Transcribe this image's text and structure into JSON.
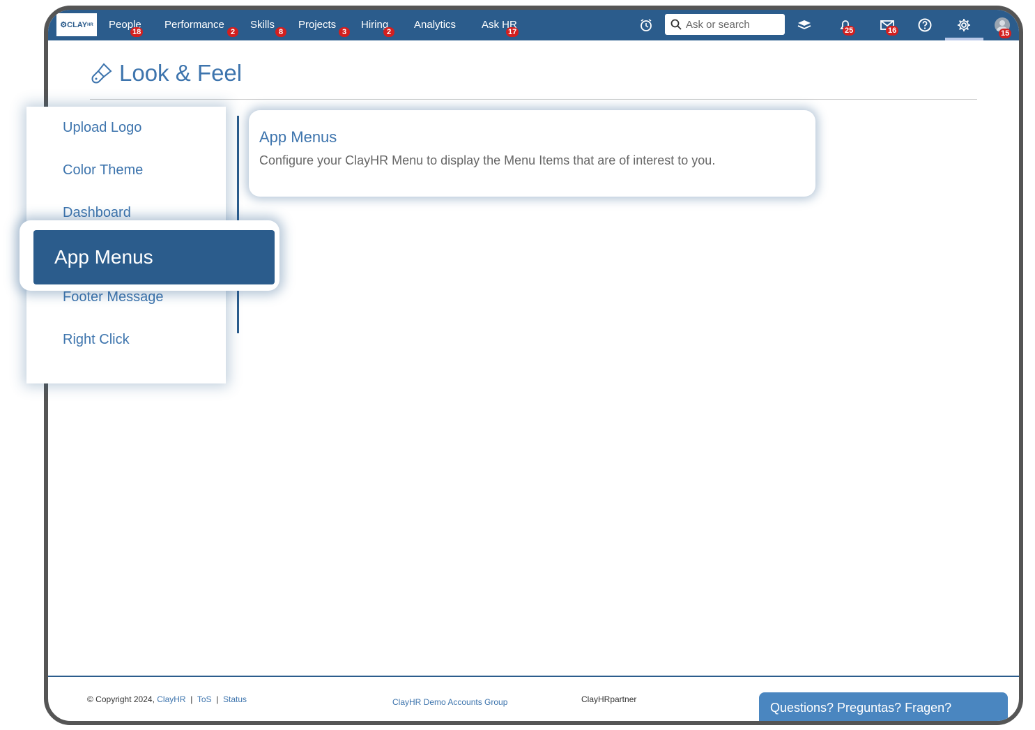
{
  "topbar": {
    "logo_text": "CLAY",
    "logo_sub": "HR",
    "nav": [
      {
        "label": "People",
        "badge": "18"
      },
      {
        "label": "Performance",
        "badge": "2"
      },
      {
        "label": "Skills",
        "badge": "8"
      },
      {
        "label": "Projects",
        "badge": "3"
      },
      {
        "label": "Hiring",
        "badge": "2"
      },
      {
        "label": "Analytics"
      },
      {
        "label": "Ask HR",
        "badge": "17"
      }
    ],
    "search_placeholder": "Ask or search",
    "notifications_badge": "25",
    "messages_badge": "16",
    "profile_badge": "15"
  },
  "page": {
    "title": "Look & Feel"
  },
  "sidebar": {
    "items": [
      "Upload Logo",
      "Color Theme",
      "Dashboard",
      "App Menus",
      "Footer Message",
      "Right Click"
    ],
    "active": "App Menus"
  },
  "card": {
    "title": "App Menus",
    "description": "Configure your ClayHR Menu to display the Menu Items that are of interest to you."
  },
  "footer": {
    "copyright": "© Copyright 2024,",
    "brand_link": "ClayHR",
    "tos": "ToS",
    "status": "Status",
    "separator": "|",
    "group": "ClayHR Demo Accounts Group",
    "partner": "ClayHRpartner",
    "questions": "Questions? Preguntas? Fragen?"
  },
  "colors": {
    "primary": "#2b5c8c",
    "accent_text": "#3d74ad",
    "badge": "#d31f1f"
  }
}
